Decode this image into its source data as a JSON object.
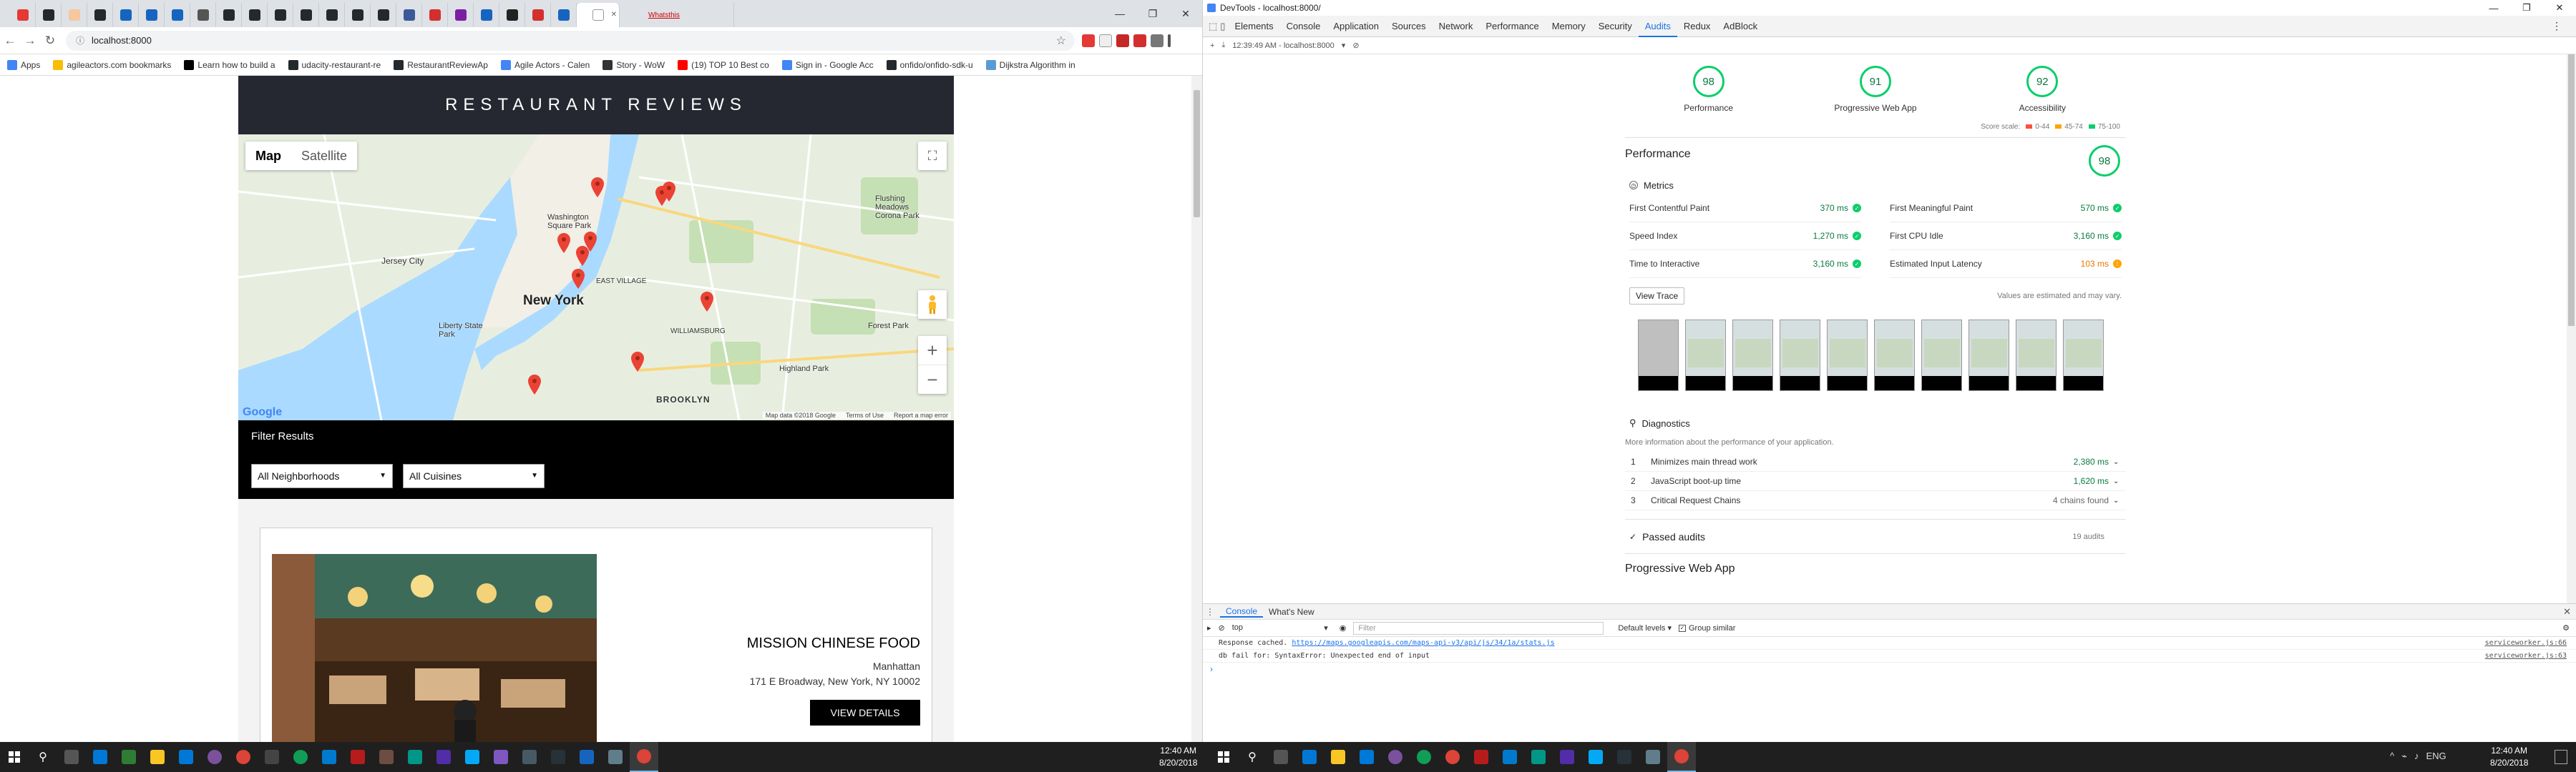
{
  "browser": {
    "last_tab_label": "Whatsthis",
    "url": "localhost:8000",
    "bookmarks": [
      {
        "label": "Apps",
        "color": "#4285f4"
      },
      {
        "label": "agileactors.com bookmarks",
        "color": "#fbbc05"
      },
      {
        "label": "Learn how to build a",
        "color": "#000000"
      },
      {
        "label": "udacity-restaurant-re",
        "color": "#24292e"
      },
      {
        "label": "RestaurantReviewAp",
        "color": "#24292e"
      },
      {
        "label": "Agile Actors - Calen",
        "color": "#4285f4"
      },
      {
        "label": "Story - WoW",
        "color": "#333333"
      },
      {
        "label": "(19) TOP 10 Best co",
        "color": "#ff0000"
      },
      {
        "label": "Sign in - Google Acc",
        "color": "#4285f4"
      },
      {
        "label": "onfido/onfido-sdk-u",
        "color": "#24292e"
      },
      {
        "label": "Dijkstra Algorithm in",
        "color": "#5b9bd5"
      }
    ]
  },
  "site": {
    "title": "RESTAURANT REVIEWS",
    "map": {
      "map_button": "Map",
      "satellite_button": "Satellite",
      "labels": {
        "jersey_city": "Jersey City",
        "new_york": "New York",
        "brooklyn": "BROOKLYN",
        "williamsburg": "WILLIAMSBURG",
        "liberty": "Liberty State Park",
        "washington_sq": "Washington Square Park",
        "flushing": "Flushing Meadows Corona Park",
        "forest": "Forest Park",
        "highland": "Highland Park",
        "east_village": "EAST VILLAGE"
      },
      "logo": "Google",
      "attribution": [
        "Map data ©2018 Google",
        "Terms of Use",
        "Report a map error"
      ]
    },
    "filter": {
      "title": "Filter Results",
      "neighborhood": "All Neighborhoods",
      "cuisine": "All Cuisines"
    },
    "restaurant": {
      "name": "MISSION CHINESE FOOD",
      "neighborhood": "Manhattan",
      "address": "171 E Broadway, New York, NY 10002",
      "button": "VIEW DETAILS"
    }
  },
  "devtools": {
    "title": "DevTools - localhost:8000/",
    "tabs": [
      "Elements",
      "Console",
      "Application",
      "Sources",
      "Network",
      "Performance",
      "Memory",
      "Security",
      "Audits",
      "Redux",
      "AdBlock"
    ],
    "active_tab": "Audits",
    "audit_bar": "12:39:49 AM - localhost:8000",
    "gauges": [
      {
        "score": "98",
        "label": "Performance"
      },
      {
        "score": "91",
        "label": "Progressive Web App"
      },
      {
        "score": "92",
        "label": "Accessibility"
      }
    ],
    "scale": {
      "label": "Score scale:",
      "ranges": [
        {
          "text": "0-44",
          "color": "#ff4e42"
        },
        {
          "text": "45-74",
          "color": "#ffa400"
        },
        {
          "text": "75-100",
          "color": "#0cce6b"
        }
      ]
    },
    "performance": {
      "title": "Performance",
      "score": "98",
      "metrics_title": "Metrics",
      "metrics": [
        {
          "label": "First Contentful Paint",
          "value": "370 ms",
          "status": "pass"
        },
        {
          "label": "First Meaningful Paint",
          "value": "570 ms",
          "status": "pass"
        },
        {
          "label": "Speed Index",
          "value": "1,270 ms",
          "status": "pass"
        },
        {
          "label": "First CPU Idle",
          "value": "3,160 ms",
          "status": "pass"
        },
        {
          "label": "Time to Interactive",
          "value": "3,160 ms",
          "status": "pass"
        },
        {
          "label": "Estimated Input Latency",
          "value": "103 ms",
          "status": "average"
        }
      ],
      "view_trace": "View Trace",
      "trace_note": "Values are estimated and may vary.",
      "diagnostics_title": "Diagnostics",
      "diagnostics_desc": "More information about the performance of your application.",
      "diagnostics": [
        {
          "n": "1",
          "label": "Minimizes main thread work",
          "value": "2,380 ms"
        },
        {
          "n": "2",
          "label": "JavaScript boot-up time",
          "value": "1,620 ms"
        },
        {
          "n": "3",
          "label": "Critical Request Chains",
          "value": "4 chains found"
        }
      ],
      "passed": "Passed audits",
      "passed_count": "19 audits"
    },
    "pwa_title": "Progressive Web App",
    "drawer": {
      "tabs": [
        "Console",
        "What's New"
      ],
      "context": "top",
      "filter_placeholder": "Filter",
      "levels": "Default levels",
      "group_similar": "Group similar",
      "logs": [
        {
          "prefix": "Response cached. ",
          "link": "https://maps.googleapis.com/maps-api-v3/api/js/34/1a/stats.js",
          "source": "serviceworker.js:66"
        },
        {
          "prefix": "db fail for: SyntaxError: Unexpected end of input",
          "link": "",
          "source": "serviceworker.js:63"
        }
      ]
    }
  },
  "taskbar": {
    "left_time": "12:40 AM",
    "left_date": "8/20/2018",
    "right_time": "12:40 AM",
    "right_date": "8/20/2018",
    "lang": "ENG"
  }
}
